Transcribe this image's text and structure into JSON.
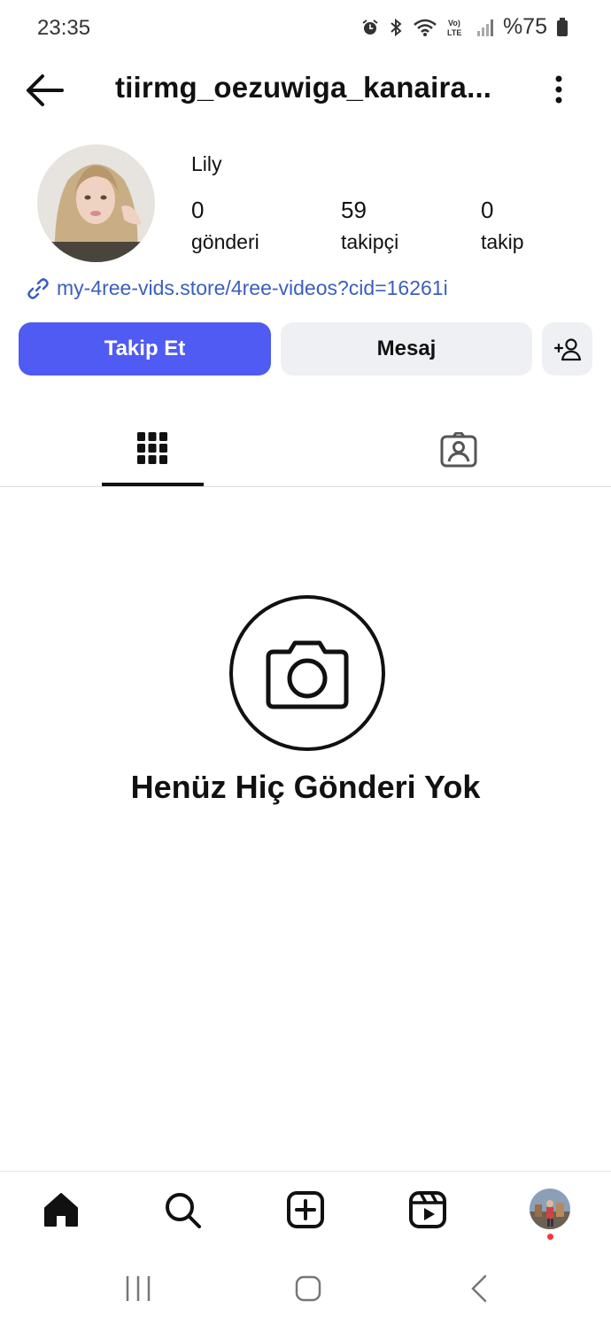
{
  "status_bar": {
    "time": "23:35",
    "battery_text": "%75",
    "icons": [
      "alarm-icon",
      "bluetooth-icon",
      "wifi-icon",
      "volte-icon",
      "signal-icon",
      "battery-icon"
    ]
  },
  "header": {
    "username": "tiirmg_oezuwiga_kanaira...",
    "icons": [
      "back-arrow-icon",
      "more-options-icon"
    ]
  },
  "profile": {
    "display_name": "Lily",
    "stats": [
      {
        "value": "0",
        "label": "gönderi"
      },
      {
        "value": "59",
        "label": "takipçi"
      },
      {
        "value": "0",
        "label": "takip"
      }
    ],
    "link": "my-4ree-vids.store/4ree-videos?cid=16261i"
  },
  "actions": {
    "follow_label": "Takip Et",
    "message_label": "Mesaj",
    "follow_color": "#4f5bf2"
  },
  "tabs": [
    {
      "name": "posts-grid",
      "icon": "grid-icon",
      "active": true
    },
    {
      "name": "tagged",
      "icon": "tagged-person-icon",
      "active": false
    }
  ],
  "empty_state": {
    "text": "Henüz Hiç Gönderi Yok",
    "icon": "camera-icon"
  },
  "bottom_nav": {
    "items": [
      "home-icon",
      "search-icon",
      "create-icon",
      "reels-icon",
      "profile-avatar"
    ],
    "notification_dot_color": "#ff3040"
  },
  "system_nav": [
    "recent-apps-icon",
    "home-button-icon",
    "back-button-icon"
  ]
}
